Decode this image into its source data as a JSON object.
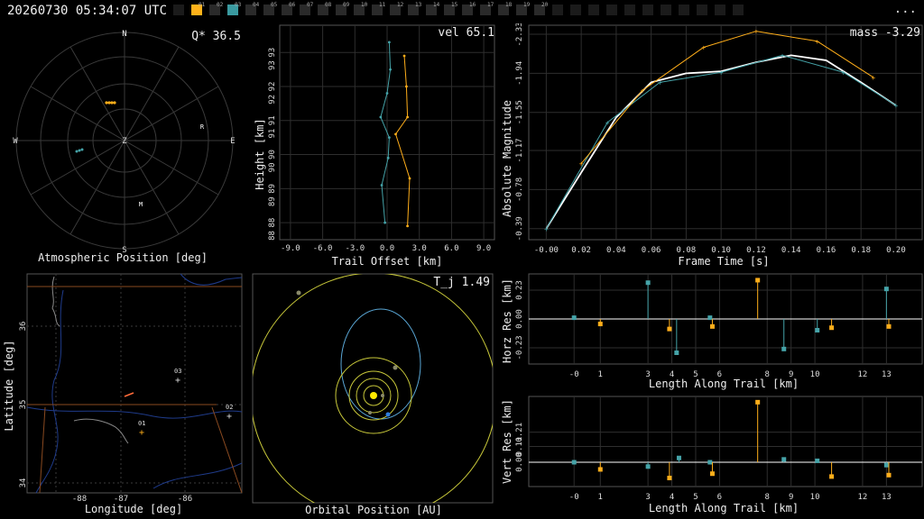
{
  "header": {
    "timestamp": "20260730 05:34:07 UTC",
    "menu_label": "...",
    "cameras": [
      {
        "label": "",
        "state": "off"
      },
      {
        "label": "01",
        "state": "selected-orange"
      },
      {
        "label": "02",
        "state": "on"
      },
      {
        "label": "03",
        "state": "selected-teal"
      },
      {
        "label": "04",
        "state": "on"
      },
      {
        "label": "05",
        "state": "on"
      },
      {
        "label": "06",
        "state": "on"
      },
      {
        "label": "07",
        "state": "on"
      },
      {
        "label": "08",
        "state": "on"
      },
      {
        "label": "09",
        "state": "on"
      },
      {
        "label": "10",
        "state": "on"
      },
      {
        "label": "11",
        "state": "on"
      },
      {
        "label": "12",
        "state": "on"
      },
      {
        "label": "13",
        "state": "on"
      },
      {
        "label": "14",
        "state": "on"
      },
      {
        "label": "15",
        "state": "on"
      },
      {
        "label": "16",
        "state": "on"
      },
      {
        "label": "17",
        "state": "on"
      },
      {
        "label": "18",
        "state": "on"
      },
      {
        "label": "19",
        "state": "on"
      },
      {
        "label": "20",
        "state": "on"
      },
      {
        "label": "",
        "state": "off"
      },
      {
        "label": "",
        "state": "off"
      },
      {
        "label": "",
        "state": "off"
      },
      {
        "label": "",
        "state": "off"
      },
      {
        "label": "",
        "state": "off"
      },
      {
        "label": "",
        "state": "off"
      },
      {
        "label": "",
        "state": "off"
      },
      {
        "label": "",
        "state": "off"
      },
      {
        "label": "",
        "state": "off"
      },
      {
        "label": "",
        "state": "off"
      },
      {
        "label": "",
        "state": "off"
      }
    ]
  },
  "colors": {
    "orange": "#ffae1a",
    "teal": "#45a3a8",
    "white": "#ffffff",
    "grid": "#3a3a3a",
    "yellow": "#e6e63c"
  },
  "polar": {
    "title": "Atmospheric Position [deg]",
    "readout": "Q* 36.5",
    "cardinals": {
      "n": "N",
      "s": "S",
      "e": "E",
      "w": "W",
      "z": "Z"
    },
    "station_labels": [
      "R",
      "M"
    ]
  },
  "trail": {
    "title": "Trail Offset [km]",
    "ylabel": "Height [km]",
    "readout": "vel 65.1",
    "xticks": [
      "-9.0",
      "-6.0",
      "-3.0",
      "0.0",
      "3.0",
      "6.0",
      "9.0"
    ],
    "yticks": [
      "88",
      "89",
      "90",
      "91",
      "92",
      "93"
    ],
    "yticks_right": [
      "88",
      "89",
      "90",
      "91",
      "92",
      "93"
    ]
  },
  "lightcurve": {
    "title": "Frame Time [s]",
    "ylabel": "Absolute Magnitude",
    "readout": "mass -3.29",
    "xticks": [
      "-0.00",
      "0.02",
      "0.04",
      "0.06",
      "0.08",
      "0.10",
      "0.12",
      "0.14",
      "0.16",
      "0.18",
      "0.20"
    ],
    "yticks": [
      "-2.33",
      "-1.94",
      "-1.55",
      "-1.17",
      "-0.78",
      "-0.39"
    ]
  },
  "map": {
    "title": "Longitude [deg]",
    "ylabel": "Latitude [deg]",
    "xticks": [
      "-88",
      "-87",
      "-86"
    ],
    "yticks": [
      "36",
      "35",
      "34"
    ],
    "stations": [
      "03",
      "01",
      "02"
    ]
  },
  "orbit": {
    "title": "Orbital Position [AU]",
    "readout": "T_j 1.49"
  },
  "horz": {
    "title": "Length Along Trail [km]",
    "ylabel": "Horz Res [km]",
    "yticks": [
      "0.23",
      "0.00",
      "-0.23"
    ],
    "xticks": [
      "-0",
      "1",
      "3",
      "4",
      "5",
      "6",
      "8",
      "9",
      "10",
      "12",
      "13"
    ]
  },
  "vert": {
    "title": "Length Along Trail [km]",
    "ylabel": "Vert Res [km]",
    "yticks": [
      "0.21",
      "0.11",
      "0.00"
    ],
    "xticks": [
      "-0",
      "1",
      "3",
      "4",
      "5",
      "6",
      "8",
      "9",
      "10",
      "12",
      "13"
    ]
  },
  "chart_data": [
    {
      "type": "line",
      "name": "trail-offset",
      "xlabel": "Trail Offset [km]",
      "ylabel": "Height [km]",
      "xlim": [
        -10,
        10
      ],
      "series": [
        {
          "name": "",
          "color": "teal",
          "points": [
            [
              0.2,
              93.3
            ],
            [
              0.3,
              92.5
            ],
            [
              0.0,
              91.8
            ],
            [
              -0.6,
              91.1
            ],
            [
              0.2,
              90.5
            ],
            [
              0.1,
              89.9
            ],
            [
              -0.5,
              89.1
            ],
            [
              -0.2,
              88.0
            ]
          ]
        },
        {
          "name": "",
          "color": "orange",
          "points": [
            [
              1.6,
              92.9
            ],
            [
              1.8,
              92.0
            ],
            [
              1.9,
              91.1
            ],
            [
              0.8,
              90.6
            ],
            [
              2.1,
              89.3
            ],
            [
              1.9,
              87.9
            ]
          ]
        }
      ]
    },
    {
      "type": "line",
      "name": "light-curve",
      "xlabel": "Frame Time [s]",
      "ylabel": "Absolute Magnitude",
      "xlim": [
        -0.01,
        0.215
      ],
      "series": [
        {
          "name": "",
          "color": "white",
          "points": [
            [
              0.0,
              -0.39
            ],
            [
              0.02,
              -0.95
            ],
            [
              0.04,
              -1.5
            ],
            [
              0.06,
              -1.85
            ],
            [
              0.08,
              -1.94
            ],
            [
              0.1,
              -1.96
            ],
            [
              0.12,
              -2.05
            ],
            [
              0.14,
              -2.12
            ],
            [
              0.16,
              -2.07
            ],
            [
              0.18,
              -1.85
            ],
            [
              0.2,
              -1.62
            ]
          ]
        },
        {
          "name": "",
          "color": "teal",
          "points": [
            [
              0.0,
              -0.39
            ],
            [
              0.035,
              -1.45
            ],
            [
              0.065,
              -1.85
            ],
            [
              0.1,
              -1.95
            ],
            [
              0.135,
              -2.12
            ],
            [
              0.17,
              -1.95
            ],
            [
              0.2,
              -1.62
            ]
          ]
        },
        {
          "name": "",
          "color": "orange",
          "points": [
            [
              0.02,
              -1.04
            ],
            [
              0.055,
              -1.77
            ],
            [
              0.09,
              -2.2
            ],
            [
              0.12,
              -2.36
            ],
            [
              0.155,
              -2.26
            ],
            [
              0.187,
              -1.9
            ]
          ]
        }
      ]
    },
    {
      "type": "scatter",
      "name": "horizontal-residuals",
      "xlabel": "Length Along Trail [km]",
      "ylabel": "Horz Res [km]",
      "series": [
        {
          "name": "",
          "color": "teal",
          "points": [
            [
              -0.1,
              0.01
            ],
            [
              3.0,
              0.29
            ],
            [
              4.2,
              -0.27
            ],
            [
              5.6,
              0.01
            ],
            [
              8.7,
              -0.24
            ],
            [
              10.1,
              -0.09
            ],
            [
              13.0,
              0.24
            ]
          ]
        },
        {
          "name": "",
          "color": "orange",
          "points": [
            [
              1.0,
              -0.04
            ],
            [
              3.9,
              -0.08
            ],
            [
              5.7,
              -0.06
            ],
            [
              7.6,
              0.31
            ],
            [
              10.7,
              -0.07
            ],
            [
              13.1,
              -0.06
            ]
          ]
        }
      ]
    },
    {
      "type": "scatter",
      "name": "vertical-residuals",
      "xlabel": "Length Along Trail [km]",
      "ylabel": "Vert Res [km]",
      "series": [
        {
          "name": "",
          "color": "teal",
          "points": [
            [
              -0.1,
              0.0
            ],
            [
              3.0,
              -0.03
            ],
            [
              4.3,
              0.03
            ],
            [
              5.6,
              0.0
            ],
            [
              8.7,
              0.02
            ],
            [
              10.1,
              0.01
            ],
            [
              13.0,
              -0.02
            ]
          ]
        },
        {
          "name": "",
          "color": "orange",
          "points": [
            [
              1.0,
              -0.05
            ],
            [
              3.9,
              -0.11
            ],
            [
              5.7,
              -0.08
            ],
            [
              7.6,
              0.42
            ],
            [
              10.7,
              -0.1
            ],
            [
              13.1,
              -0.09
            ]
          ]
        }
      ]
    }
  ]
}
